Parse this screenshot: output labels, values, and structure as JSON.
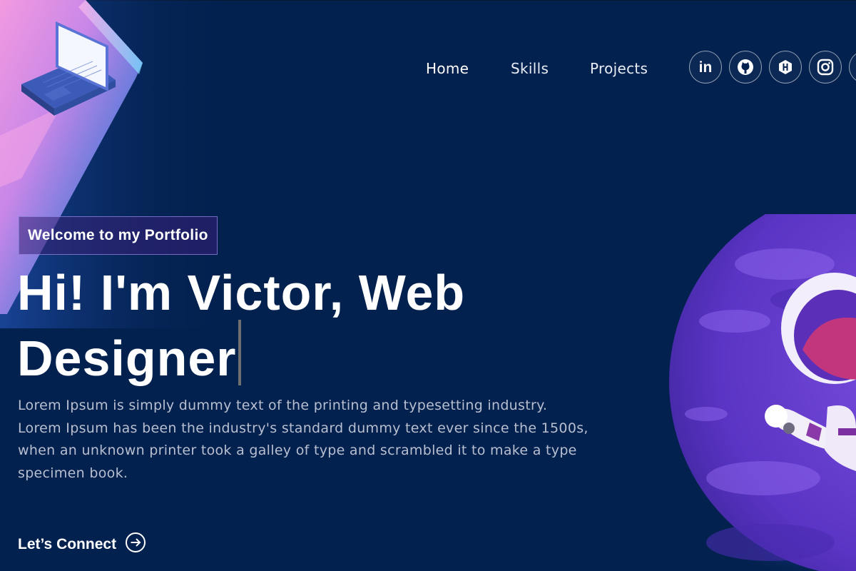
{
  "nav": {
    "links": [
      {
        "label": "Home",
        "active": true
      },
      {
        "label": "Skills",
        "active": false
      },
      {
        "label": "Projects",
        "active": false
      }
    ],
    "social": [
      {
        "icon": "linkedin-icon",
        "label": "in"
      },
      {
        "icon": "github-icon"
      },
      {
        "icon": "hackerrank-icon"
      },
      {
        "icon": "instagram-icon"
      }
    ]
  },
  "hero": {
    "tagline": "Welcome to my Portfolio",
    "headline_line1": "Hi! I'm Victor, Web",
    "headline_line2": "Designer",
    "intro": "Lorem Ipsum is simply dummy text of the printing and typesetting industry. Lorem Ipsum has been the industry's standard dummy text ever since the 1500s, when an unknown printer took a galley of type and scrambled it to make a type specimen book.",
    "cta_label": "Let’s Connect",
    "cta_icon": "arrow-right-circle-icon"
  },
  "colors": {
    "background": "#03214f",
    "text": "#ffffff",
    "muted_text": "#b8bfd0",
    "tagline_border": "#a9a0ff",
    "planet": "#6b3fd0",
    "art_gradient_start": "#f08ad8",
    "art_gradient_end": "#1e63c8"
  }
}
